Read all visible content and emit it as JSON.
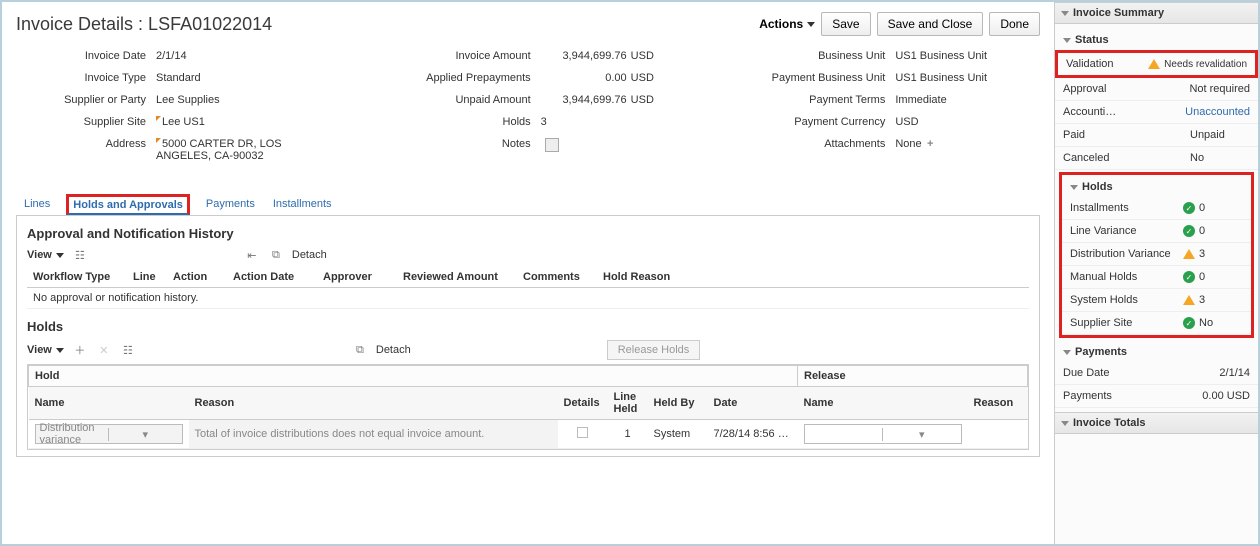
{
  "header": {
    "title": "Invoice Details : LSFA01022014",
    "actions_label": "Actions",
    "save": "Save",
    "save_close": "Save and Close",
    "done": "Done"
  },
  "details": {
    "left": {
      "invoice_date_label": "Invoice Date",
      "invoice_date": "2/1/14",
      "invoice_type_label": "Invoice Type",
      "invoice_type": "Standard",
      "supplier_label": "Supplier or Party",
      "supplier": "Lee Supplies",
      "site_label": "Supplier Site",
      "site": "Lee US1",
      "address_label": "Address",
      "address": "5000 CARTER DR, LOS ANGELES, CA-90032"
    },
    "mid": {
      "inv_amount_label": "Invoice Amount",
      "inv_amount": "3,944,699.76",
      "inv_cur": "USD",
      "applied_label": "Applied Prepayments",
      "applied": "0.00",
      "applied_cur": "USD",
      "unpaid_label": "Unpaid Amount",
      "unpaid": "3,944,699.76",
      "unpaid_cur": "USD",
      "holds_label": "Holds",
      "holds": "3",
      "notes_label": "Notes"
    },
    "right": {
      "bu_label": "Business Unit",
      "bu": "US1 Business Unit",
      "pbu_label": "Payment Business Unit",
      "pbu": "US1 Business Unit",
      "terms_label": "Payment Terms",
      "terms": "Immediate",
      "currency_label": "Payment Currency",
      "currency": "USD",
      "attach_label": "Attachments",
      "attach": "None"
    }
  },
  "tabs": {
    "lines": "Lines",
    "holds_approvals": "Holds and Approvals",
    "payments": "Payments",
    "installments": "Installments"
  },
  "approval": {
    "title": "Approval and Notification History",
    "view": "View",
    "detach": "Detach",
    "cols": {
      "workflow": "Workflow Type",
      "line": "Line",
      "action": "Action",
      "action_date": "Action Date",
      "approver": "Approver",
      "reviewed": "Reviewed Amount",
      "comments": "Comments",
      "hold_reason": "Hold Reason"
    },
    "empty": "No approval or notification history."
  },
  "holds": {
    "title": "Holds",
    "view": "View",
    "detach": "Detach",
    "release_btn": "Release Holds",
    "group_hold": "Hold",
    "group_release": "Release",
    "cols": {
      "name": "Name",
      "reason": "Reason",
      "details": "Details",
      "line_held": "Line Held",
      "held_by": "Held By",
      "date": "Date",
      "rel_name": "Name",
      "rel_reason": "Reason"
    },
    "row1": {
      "name": "Distribution variance",
      "reason": "Total of invoice distributions does not equal invoice amount.",
      "line_held": "1",
      "held_by": "System",
      "date": "7/28/14 8:56 …"
    }
  },
  "sidebar": {
    "summary_title": "Invoice Summary",
    "status_title": "Status",
    "status": {
      "validation_label": "Validation",
      "validation_val": "Needs revalidation",
      "approval_label": "Approval",
      "approval_val": "Not required",
      "accounting_label": "Accounti…",
      "accounting_val": "Unaccounted",
      "paid_label": "Paid",
      "paid_val": "Unpaid",
      "canceled_label": "Canceled",
      "canceled_val": "No"
    },
    "holds_title": "Holds",
    "holds": {
      "installments_label": "Installments",
      "installments_val": "0",
      "line_var_label": "Line Variance",
      "line_var_val": "0",
      "dist_var_label": "Distribution Variance",
      "dist_var_val": "3",
      "manual_label": "Manual Holds",
      "manual_val": "0",
      "system_label": "System Holds",
      "system_val": "3",
      "site_label": "Supplier Site",
      "site_val": "No"
    },
    "payments_title": "Payments",
    "payments": {
      "due_label": "Due Date",
      "due_val": "2/1/14",
      "pay_label": "Payments",
      "pay_val": "0.00 USD"
    },
    "totals_title": "Invoice Totals"
  }
}
